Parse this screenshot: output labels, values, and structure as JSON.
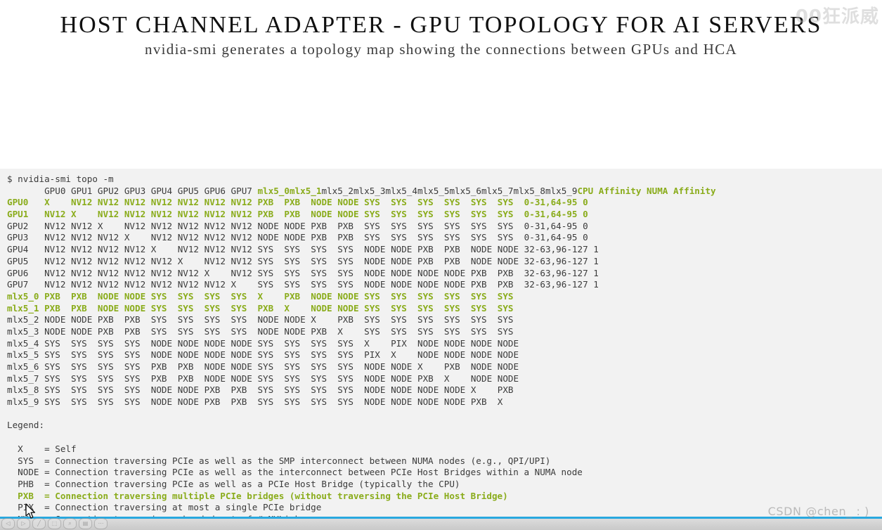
{
  "slide": {
    "title": "HOST CHANNEL ADAPTER - GPU TOPOLOGY FOR AI SERVERS",
    "subtitle": "nvidia-smi generates a topology map showing the connections between GPUs and HCA"
  },
  "watermarks": {
    "top_right": "00狂派威",
    "bottom_right": "CSDN @chen_  : )"
  },
  "colors": {
    "highlight_green": "#8aac1b",
    "terminal_bg": "#f2f2f2",
    "page_bg": "#ffffff",
    "text": "#3b3b3b",
    "accent_rule": "#29a8df"
  },
  "terminal": {
    "prompt": "$ nvidia-smi topo -m",
    "header_row": {
      "indent": "    ",
      "plain_before": "GPU0 GPU1 GPU2 GPU3 GPU4 GPU5 GPU6 GPU7 ",
      "highlight_a": "mlx5_0 mlx5_1",
      "plain_middle": " mlx5_2 mlx5_3 mlx5_4 mlx5_5 mlx5_6 mlx5_7 mlx5_8 mlx5_9 ",
      "highlight_b": "CPU Affinity NUMA Affinity"
    },
    "columns": [
      "GPU0",
      "GPU1",
      "GPU2",
      "GPU3",
      "GPU4",
      "GPU5",
      "GPU6",
      "GPU7",
      "mlx5_0",
      "mlx5_1",
      "mlx5_2",
      "mlx5_3",
      "mlx5_4",
      "mlx5_5",
      "mlx5_6",
      "mlx5_7",
      "mlx5_8",
      "mlx5_9",
      "CPU Affinity",
      "NUMA Affinity"
    ],
    "highlighted_columns": [
      "mlx5_0",
      "mlx5_1",
      "CPU Affinity",
      "NUMA Affinity"
    ],
    "highlighted_rows": [
      "GPU0",
      "GPU1",
      "mlx5_0",
      "mlx5_1"
    ],
    "rows": [
      {
        "label": "GPU0",
        "highlight": true,
        "cells": [
          "X",
          "NV12",
          "NV12",
          "NV12",
          "NV12",
          "NV12",
          "NV12",
          "NV12",
          "PXB",
          "PXB",
          "NODE",
          "NODE",
          "SYS",
          "SYS",
          "SYS",
          "SYS",
          "SYS",
          "SYS"
        ],
        "cpu_affinity": "0-31,64-95",
        "numa_affinity": "0"
      },
      {
        "label": "GPU1",
        "highlight": true,
        "cells": [
          "NV12",
          "X",
          "NV12",
          "NV12",
          "NV12",
          "NV12",
          "NV12",
          "NV12",
          "PXB",
          "PXB",
          "NODE",
          "NODE",
          "SYS",
          "SYS",
          "SYS",
          "SYS",
          "SYS",
          "SYS"
        ],
        "cpu_affinity": "0-31,64-95",
        "numa_affinity": "0"
      },
      {
        "label": "GPU2",
        "highlight": false,
        "cells": [
          "NV12",
          "NV12",
          "X",
          "NV12",
          "NV12",
          "NV12",
          "NV12",
          "NV12",
          "NODE",
          "NODE",
          "PXB",
          "PXB",
          "SYS",
          "SYS",
          "SYS",
          "SYS",
          "SYS",
          "SYS"
        ],
        "cpu_affinity": "0-31,64-95",
        "numa_affinity": "0"
      },
      {
        "label": "GPU3",
        "highlight": false,
        "cells": [
          "NV12",
          "NV12",
          "NV12",
          "X",
          "NV12",
          "NV12",
          "NV12",
          "NV12",
          "NODE",
          "NODE",
          "PXB",
          "PXB",
          "SYS",
          "SYS",
          "SYS",
          "SYS",
          "SYS",
          "SYS"
        ],
        "cpu_affinity": "0-31,64-95",
        "numa_affinity": "0"
      },
      {
        "label": "GPU4",
        "highlight": false,
        "cells": [
          "NV12",
          "NV12",
          "NV12",
          "NV12",
          "X",
          "NV12",
          "NV12",
          "NV12",
          "SYS",
          "SYS",
          "SYS",
          "SYS",
          "NODE",
          "NODE",
          "PXB",
          "PXB",
          "NODE",
          "NODE"
        ],
        "cpu_affinity": "32-63,96-127",
        "numa_affinity": "1"
      },
      {
        "label": "GPU5",
        "highlight": false,
        "cells": [
          "NV12",
          "NV12",
          "NV12",
          "NV12",
          "NV12",
          "X",
          "NV12",
          "NV12",
          "SYS",
          "SYS",
          "SYS",
          "SYS",
          "NODE",
          "NODE",
          "PXB",
          "PXB",
          "NODE",
          "NODE"
        ],
        "cpu_affinity": "32-63,96-127",
        "numa_affinity": "1"
      },
      {
        "label": "GPU6",
        "highlight": false,
        "cells": [
          "NV12",
          "NV12",
          "NV12",
          "NV12",
          "NV12",
          "NV12",
          "X",
          "NV12",
          "SYS",
          "SYS",
          "SYS",
          "SYS",
          "NODE",
          "NODE",
          "NODE",
          "NODE",
          "PXB",
          "PXB"
        ],
        "cpu_affinity": "32-63,96-127",
        "numa_affinity": "1"
      },
      {
        "label": "GPU7",
        "highlight": false,
        "cells": [
          "NV12",
          "NV12",
          "NV12",
          "NV12",
          "NV12",
          "NV12",
          "NV12",
          "X",
          "SYS",
          "SYS",
          "SYS",
          "SYS",
          "NODE",
          "NODE",
          "NODE",
          "NODE",
          "PXB",
          "PXB"
        ],
        "cpu_affinity": "32-63,96-127",
        "numa_affinity": "1"
      },
      {
        "label": "mlx5_0",
        "highlight": true,
        "cells": [
          "PXB",
          "PXB",
          "NODE",
          "NODE",
          "SYS",
          "SYS",
          "SYS",
          "SYS",
          "X",
          "PXB",
          "NODE",
          "NODE",
          "SYS",
          "SYS",
          "SYS",
          "SYS",
          "SYS",
          "SYS"
        ],
        "cpu_affinity": "",
        "numa_affinity": ""
      },
      {
        "label": "mlx5_1",
        "highlight": true,
        "cells": [
          "PXB",
          "PXB",
          "NODE",
          "NODE",
          "SYS",
          "SYS",
          "SYS",
          "SYS",
          "PXB",
          "X",
          "NODE",
          "NODE",
          "SYS",
          "SYS",
          "SYS",
          "SYS",
          "SYS",
          "SYS"
        ],
        "cpu_affinity": "",
        "numa_affinity": ""
      },
      {
        "label": "mlx5_2",
        "highlight": false,
        "cells": [
          "NODE",
          "NODE",
          "PXB",
          "PXB",
          "SYS",
          "SYS",
          "SYS",
          "SYS",
          "NODE",
          "NODE",
          "X",
          "PXB",
          "SYS",
          "SYS",
          "SYS",
          "SYS",
          "SYS",
          "SYS"
        ],
        "cpu_affinity": "",
        "numa_affinity": ""
      },
      {
        "label": "mlx5_3",
        "highlight": false,
        "cells": [
          "NODE",
          "NODE",
          "PXB",
          "PXB",
          "SYS",
          "SYS",
          "SYS",
          "SYS",
          "NODE",
          "NODE",
          "PXB",
          "X",
          "SYS",
          "SYS",
          "SYS",
          "SYS",
          "SYS",
          "SYS"
        ],
        "cpu_affinity": "",
        "numa_affinity": ""
      },
      {
        "label": "mlx5_4",
        "highlight": false,
        "cells": [
          "SYS",
          "SYS",
          "SYS",
          "SYS",
          "NODE",
          "NODE",
          "NODE",
          "NODE",
          "SYS",
          "SYS",
          "SYS",
          "SYS",
          "X",
          "PIX",
          "NODE",
          "NODE",
          "NODE",
          "NODE"
        ],
        "cpu_affinity": "",
        "numa_affinity": ""
      },
      {
        "label": "mlx5_5",
        "highlight": false,
        "cells": [
          "SYS",
          "SYS",
          "SYS",
          "SYS",
          "NODE",
          "NODE",
          "NODE",
          "NODE",
          "SYS",
          "SYS",
          "SYS",
          "SYS",
          "PIX",
          "X",
          "NODE",
          "NODE",
          "NODE",
          "NODE"
        ],
        "cpu_affinity": "",
        "numa_affinity": ""
      },
      {
        "label": "mlx5_6",
        "highlight": false,
        "cells": [
          "SYS",
          "SYS",
          "SYS",
          "SYS",
          "PXB",
          "PXB",
          "NODE",
          "NODE",
          "SYS",
          "SYS",
          "SYS",
          "SYS",
          "NODE",
          "NODE",
          "X",
          "PXB",
          "NODE",
          "NODE"
        ],
        "cpu_affinity": "",
        "numa_affinity": ""
      },
      {
        "label": "mlx5_7",
        "highlight": false,
        "cells": [
          "SYS",
          "SYS",
          "SYS",
          "SYS",
          "PXB",
          "PXB",
          "NODE",
          "NODE",
          "SYS",
          "SYS",
          "SYS",
          "SYS",
          "NODE",
          "NODE",
          "PXB",
          "X",
          "NODE",
          "NODE"
        ],
        "cpu_affinity": "",
        "numa_affinity": ""
      },
      {
        "label": "mlx5_8",
        "highlight": false,
        "cells": [
          "SYS",
          "SYS",
          "SYS",
          "SYS",
          "NODE",
          "NODE",
          "PXB",
          "PXB",
          "SYS",
          "SYS",
          "SYS",
          "SYS",
          "NODE",
          "NODE",
          "NODE",
          "NODE",
          "X",
          "PXB"
        ],
        "cpu_affinity": "",
        "numa_affinity": ""
      },
      {
        "label": "mlx5_9",
        "highlight": false,
        "cells": [
          "SYS",
          "SYS",
          "SYS",
          "SYS",
          "NODE",
          "NODE",
          "PXB",
          "PXB",
          "SYS",
          "SYS",
          "SYS",
          "SYS",
          "NODE",
          "NODE",
          "NODE",
          "NODE",
          "PXB",
          "X"
        ],
        "cpu_affinity": "",
        "numa_affinity": ""
      }
    ],
    "legend_title": "Legend:",
    "legend": [
      {
        "key": "X",
        "text": "= Self",
        "highlight": false
      },
      {
        "key": "SYS",
        "text": "= Connection traversing PCIe as well as the SMP interconnect between NUMA nodes (e.g., QPI/UPI)",
        "highlight": false
      },
      {
        "key": "NODE",
        "text": "= Connection traversing PCIe as well as the interconnect between PCIe Host Bridges within a NUMA node",
        "highlight": false
      },
      {
        "key": "PHB",
        "text": "= Connection traversing PCIe as well as a PCIe Host Bridge (typically the CPU)",
        "highlight": false
      },
      {
        "key": "PXB",
        "text": "= Connection traversing multiple PCIe bridges (without traversing the PCIe Host Bridge)",
        "highlight": true
      },
      {
        "key": "PIX",
        "text": "= Connection traversing at most a single PCIe bridge",
        "highlight": false
      },
      {
        "key": "NV#",
        "text": "= Connection traversing a bonded set of # NVLinks",
        "highlight": false
      }
    ]
  },
  "toolbar": {
    "icons": [
      "prev-icon",
      "play-icon",
      "pen-icon",
      "highlighter-icon",
      "zoom-icon",
      "display-icon",
      "more-icon"
    ]
  }
}
